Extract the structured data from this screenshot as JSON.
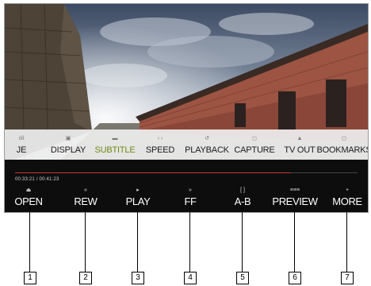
{
  "menu": {
    "items": [
      {
        "label": "JE",
        "icon": "equalizer-icon",
        "glyph": "ılıl"
      },
      {
        "label": "DISPLAY",
        "icon": "display-icon",
        "glyph": "▣"
      },
      {
        "label": "SUBTITLE",
        "icon": "subtitle-icon",
        "glyph": "▬"
      },
      {
        "label": "SPEED",
        "icon": "speed-icon",
        "glyph": "‹ ›"
      },
      {
        "label": "PLAYBACK",
        "icon": "repeat-icon",
        "glyph": "↺"
      },
      {
        "label": "CAPTURE",
        "icon": "capture-icon",
        "glyph": "◻"
      },
      {
        "label": "TV OUT",
        "icon": "tv-icon",
        "glyph": "▲"
      },
      {
        "label": "BOOKMARKS",
        "icon": "bookmark-icon",
        "glyph": "◻"
      }
    ],
    "active": "SUBTITLE",
    "active_color": "#6f8a12"
  },
  "player": {
    "time": "00:33:21 / 00:41:23",
    "progress": 0.806,
    "progress_color": "#c0392b"
  },
  "controls": [
    {
      "label": "OPEN",
      "icon": "eject-icon",
      "glyph": "⏏"
    },
    {
      "label": "REW",
      "icon": "rewind-icon",
      "glyph": "«"
    },
    {
      "label": "PLAY",
      "icon": "play-icon",
      "glyph": "▸"
    },
    {
      "label": "FF",
      "icon": "fast-forward-icon",
      "glyph": "»"
    },
    {
      "label": "A-B",
      "icon": "ab-repeat-icon",
      "glyph": "[ ]"
    },
    {
      "label": "PREVIEW",
      "icon": "preview-icon",
      "glyph": "≡≡≡"
    },
    {
      "label": "MORE",
      "icon": "more-icon",
      "glyph": "+"
    }
  ],
  "callouts": [
    "1",
    "2",
    "3",
    "4",
    "5",
    "6",
    "7"
  ]
}
